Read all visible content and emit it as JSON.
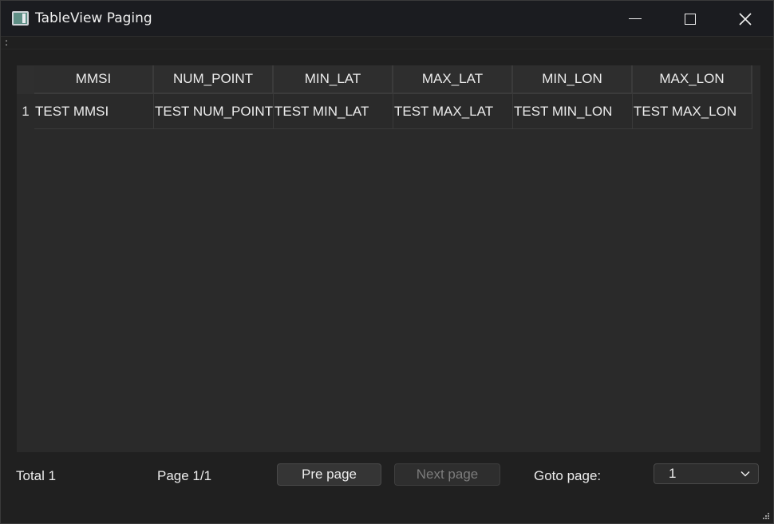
{
  "window": {
    "title": "TableView Paging"
  },
  "table": {
    "columns": [
      "MMSI",
      "NUM_POINT",
      "MIN_LAT",
      "MAX_LAT",
      "MIN_LON",
      "MAX_LON"
    ],
    "rows": [
      {
        "index": "1",
        "cells": [
          "TEST MMSI",
          "TEST NUM_POINT",
          "TEST MIN_LAT",
          "TEST MAX_LAT",
          "TEST MIN_LON",
          "TEST MAX_LON"
        ]
      }
    ]
  },
  "footer": {
    "total": "Total 1",
    "page": "Page 1/1",
    "pre_label": "Pre page",
    "next_label": "Next page",
    "goto_label": "Goto page:",
    "goto_value": "1"
  },
  "icons": {
    "app": "app-window-icon",
    "minimize": "minimize-icon",
    "maximize": "maximize-icon",
    "close": "close-icon",
    "dropdown": "chevron-down-icon"
  },
  "colors": {
    "background": "#202020",
    "table": "#2a2a2a",
    "text": "#ececec",
    "disabled_text": "#7c7c7c"
  }
}
